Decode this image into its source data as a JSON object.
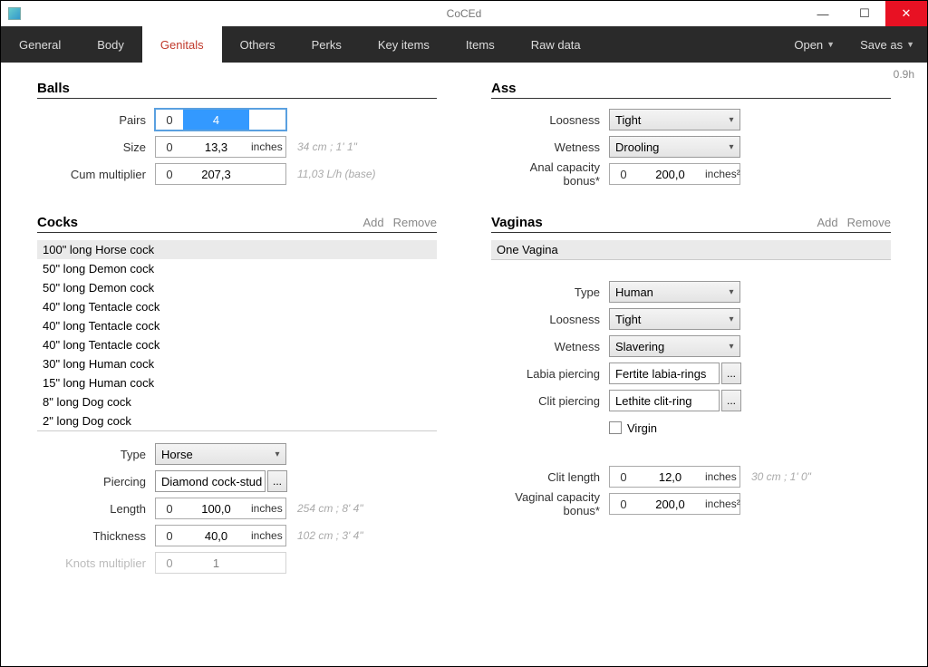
{
  "window": {
    "title": "CoCEd"
  },
  "winbtns": {
    "min": "—",
    "max": "☐",
    "close": "✕"
  },
  "tabs": [
    "General",
    "Body",
    "Genitals",
    "Others",
    "Perks",
    "Key items",
    "Items",
    "Raw data"
  ],
  "active_tab_index": 2,
  "menu": {
    "open": "Open",
    "saveas": "Save as"
  },
  "version": "0.9h",
  "balls": {
    "title": "Balls",
    "pairs_label": "Pairs",
    "pairs_left": "0",
    "pairs_val": "4",
    "size_label": "Size",
    "size_left": "0",
    "size_val": "13,3",
    "size_unit": "inches",
    "size_hint": "34 cm ; 1' 1\"",
    "cum_label": "Cum multiplier",
    "cum_left": "0",
    "cum_val": "207,3",
    "cum_hint": "11,03 L/h (base)"
  },
  "ass": {
    "title": "Ass",
    "loosness_label": "Loosness",
    "loosness_val": "Tight",
    "wetness_label": "Wetness",
    "wetness_val": "Drooling",
    "cap_label": "Anal capacity bonus*",
    "cap_left": "0",
    "cap_val": "200,0",
    "cap_unit": "inches²"
  },
  "cocks": {
    "title": "Cocks",
    "add": "Add",
    "remove": "Remove",
    "items": [
      "100\" long Horse cock",
      "50\" long Demon cock",
      "50\" long Demon cock",
      "40\" long Tentacle cock",
      "40\" long Tentacle cock",
      "40\" long Tentacle cock",
      "30\" long Human cock",
      "15\" long Human cock",
      "8\" long Dog cock",
      "2\" long Dog cock"
    ],
    "type_label": "Type",
    "type_val": "Horse",
    "piercing_label": "Piercing",
    "piercing_val": "Diamond cock-stud",
    "ellipsis": "...",
    "length_label": "Length",
    "length_left": "0",
    "length_val": "100,0",
    "length_unit": "inches",
    "length_hint": "254 cm ; 8' 4\"",
    "thick_label": "Thickness",
    "thick_left": "0",
    "thick_val": "40,0",
    "thick_unit": "inches",
    "thick_hint": "102 cm ; 3' 4\"",
    "knots_label": "Knots multiplier",
    "knots_left": "0",
    "knots_val": "1"
  },
  "vaginas": {
    "title": "Vaginas",
    "add": "Add",
    "remove": "Remove",
    "items": [
      "One Vagina"
    ],
    "type_label": "Type",
    "type_val": "Human",
    "loosness_label": "Loosness",
    "loosness_val": "Tight",
    "wetness_label": "Wetness",
    "wetness_val": "Slavering",
    "labia_label": "Labia piercing",
    "labia_val": "Fertite labia-rings",
    "ellipsis": "...",
    "clitp_label": "Clit piercing",
    "clitp_val": "Lethite clit-ring",
    "virgin_label": "Virgin",
    "clitlen_label": "Clit length",
    "clitlen_left": "0",
    "clitlen_val": "12,0",
    "clitlen_unit": "inches",
    "clitlen_hint": "30 cm ; 1' 0\"",
    "cap_label": "Vaginal capacity bonus*",
    "cap_left": "0",
    "cap_val": "200,0",
    "cap_unit": "inches²"
  }
}
